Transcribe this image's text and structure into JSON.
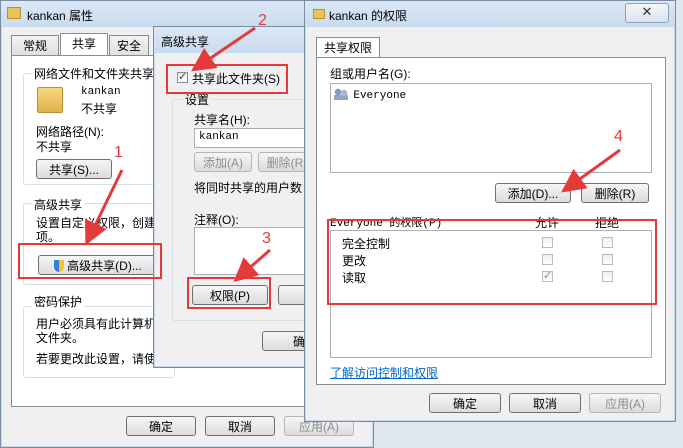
{
  "props_window": {
    "title": "kankan 属性",
    "tabs": [
      "常规",
      "共享",
      "安全"
    ],
    "network_group_label": "网络文件和文件夹共享",
    "folder_name": "kankan",
    "folder_status": "不共享",
    "network_path_label": "网络路径(N):",
    "network_path_value": "不共享",
    "share_button": "共享(S)...",
    "advanced_group_label": "高级共享",
    "advanced_desc": "设置自定义权限，创建",
    "advanced_desc2": "项。",
    "advanced_button": "高级共享(D)...",
    "password_group_label": "密码保护",
    "password_desc": "用户必须具有此计算机",
    "password_desc2": "文件夹。",
    "password_desc3": "若要更改此设置，请使",
    "ok": "确定",
    "cancel": "取消",
    "apply": "应用(A)"
  },
  "adv_window": {
    "title": "高级共享",
    "share_checkbox_label": "共享此文件夹(S)",
    "settings_label": "设置",
    "share_name_label": "共享名(H):",
    "share_name_value": "kankan",
    "add_button": "添加(A)",
    "remove_button": "删除(R)",
    "limit_label": "将同时共享的用户数",
    "comment_label": "注释(O):",
    "permissions_button": "权限(P)",
    "ok_partial": "确定"
  },
  "perm_window": {
    "title": "kankan 的权限",
    "tab": "共享权限",
    "group_label": "组或用户名(G):",
    "users": [
      "Everyone"
    ],
    "add_button": "添加(D)...",
    "remove_button": "删除(R)",
    "perm_header": "Everyone 的权限(P)",
    "allow": "允许",
    "deny": "拒绝",
    "perms": [
      {
        "name": "完全控制",
        "allow": false,
        "deny": false
      },
      {
        "name": "更改",
        "allow": false,
        "deny": false
      },
      {
        "name": "读取",
        "allow": true,
        "deny": false
      }
    ],
    "link": "了解访问控制和权限",
    "ok": "确定",
    "cancel": "取消",
    "apply": "应用(A)"
  },
  "annotations": [
    "1",
    "2",
    "3",
    "4"
  ]
}
